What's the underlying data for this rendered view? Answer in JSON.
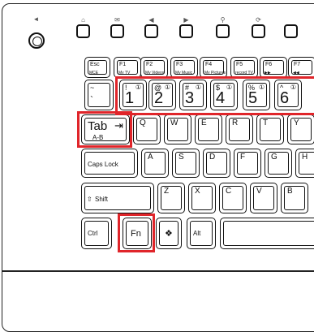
{
  "media_icons": [
    "speaker-icon",
    "home-icon",
    "mail-icon",
    "back-icon",
    "forward-icon",
    "search-icon",
    "refresh-icon"
  ],
  "function_row": [
    {
      "name": "Esc",
      "sub": "MCE"
    },
    {
      "name": "F1",
      "sub": "My TV"
    },
    {
      "name": "F2",
      "sub": "My Videos"
    },
    {
      "name": "F3",
      "sub": "My Music"
    },
    {
      "name": "F4",
      "sub": "My Pictures"
    },
    {
      "name": "F5",
      "sub": "record TV"
    },
    {
      "name": "F6",
      "sub": "▶▶"
    },
    {
      "name": "F7",
      "sub": "◀◀"
    }
  ],
  "number_row": [
    {
      "sym": "~",
      "digit": "`"
    },
    {
      "sym": "!",
      "digit": "1",
      "icon": "①"
    },
    {
      "sym": "@",
      "digit": "2",
      "icon": "①"
    },
    {
      "sym": "#",
      "digit": "3",
      "icon": "①"
    },
    {
      "sym": "$",
      "digit": "4",
      "icon": "①"
    },
    {
      "sym": "%",
      "digit": "5",
      "icon": "①"
    },
    {
      "sym": "^",
      "digit": "6",
      "icon": "①"
    }
  ],
  "tab_key": {
    "label": "Tab",
    "sub": "A-B"
  },
  "q_row": [
    "Q",
    "W",
    "E",
    "R",
    "T",
    "Y"
  ],
  "caps_key": "Caps Lock",
  "a_row": [
    "A",
    "S",
    "D",
    "F",
    "G",
    "H"
  ],
  "shift_key": "Shift",
  "z_row": [
    "Z",
    "X",
    "C",
    "V",
    "B"
  ],
  "bottom_row": {
    "ctrl": "Ctrl",
    "fn": "Fn",
    "alt": "Alt"
  },
  "highlight_color": "#e0252a"
}
